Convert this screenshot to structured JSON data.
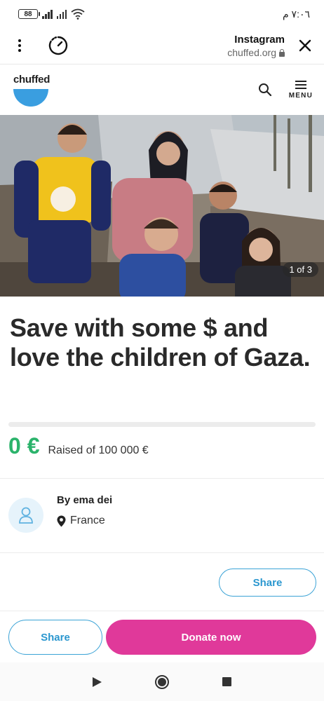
{
  "status_bar": {
    "battery": "88",
    "time": "٧:٠٦ م"
  },
  "browser": {
    "app_name": "Instagram",
    "domain": "chuffed.org",
    "icons": [
      "kebab-menu-icon",
      "timer-icon",
      "lock-icon",
      "close-icon"
    ]
  },
  "site_header": {
    "logo_text": "chuffed",
    "menu_label": "MENU",
    "icons": [
      "search-icon",
      "hamburger-icon"
    ]
  },
  "hero": {
    "counter": "1 of 3"
  },
  "campaign": {
    "title": "Save with some $ and love the children of Gaza.",
    "raised_amount": "0 €",
    "raised_text": "Raised of 100 000 €",
    "progress": 0
  },
  "organizer": {
    "name": "By ema dei",
    "location": "France",
    "icons": [
      "avatar-user-icon",
      "location-pin-icon"
    ]
  },
  "actions": {
    "share_label": "Share",
    "bottom_share_label": "Share",
    "donate_label": "Donate now"
  },
  "colors": {
    "accent_green": "#2bb36b",
    "share_blue": "#2b97cf",
    "donate_pink": "#e0399a",
    "logo_blue": "#3a9ee0"
  }
}
